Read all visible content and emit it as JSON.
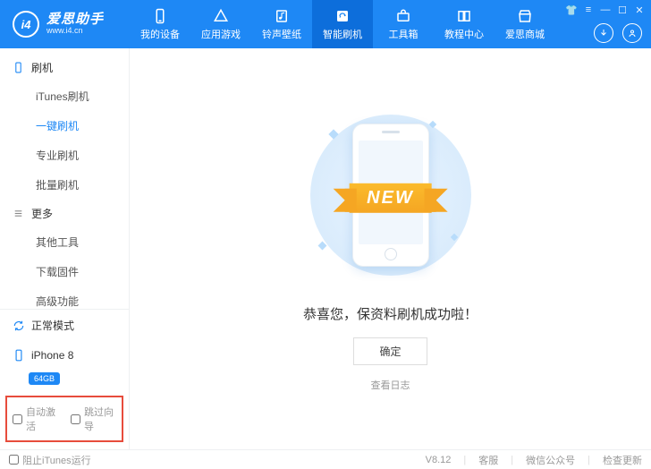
{
  "logo": {
    "icon": "i4",
    "main": "爱思助手",
    "sub": "www.i4.cn"
  },
  "nav": [
    {
      "id": "device",
      "label": "我的设备"
    },
    {
      "id": "apps",
      "label": "应用游戏"
    },
    {
      "id": "ring",
      "label": "铃声壁纸"
    },
    {
      "id": "flash",
      "label": "智能刷机",
      "active": true
    },
    {
      "id": "toolbox",
      "label": "工具箱"
    },
    {
      "id": "tutorial",
      "label": "教程中心"
    },
    {
      "id": "mall",
      "label": "爱思商城"
    }
  ],
  "sidebar": {
    "groups": [
      {
        "title": "刷机",
        "items": [
          {
            "label": "iTunes刷机"
          },
          {
            "label": "一键刷机",
            "active": true
          },
          {
            "label": "专业刷机"
          },
          {
            "label": "批量刷机"
          }
        ]
      },
      {
        "title": "更多",
        "items": [
          {
            "label": "其他工具"
          },
          {
            "label": "下载固件"
          },
          {
            "label": "高级功能"
          }
        ]
      }
    ],
    "status": "正常模式",
    "device": {
      "name": "iPhone 8",
      "storage": "64GB"
    },
    "checks": {
      "autoActivate": "自动激活",
      "skipGuide": "跳过向导"
    }
  },
  "main": {
    "ribbon": "NEW",
    "message": "恭喜您，保资料刷机成功啦！",
    "ok": "确定",
    "viewLog": "查看日志"
  },
  "footer": {
    "blockItunes": "阻止iTunes运行",
    "version": "V8.12",
    "links": [
      "客服",
      "微信公众号",
      "检查更新"
    ]
  }
}
